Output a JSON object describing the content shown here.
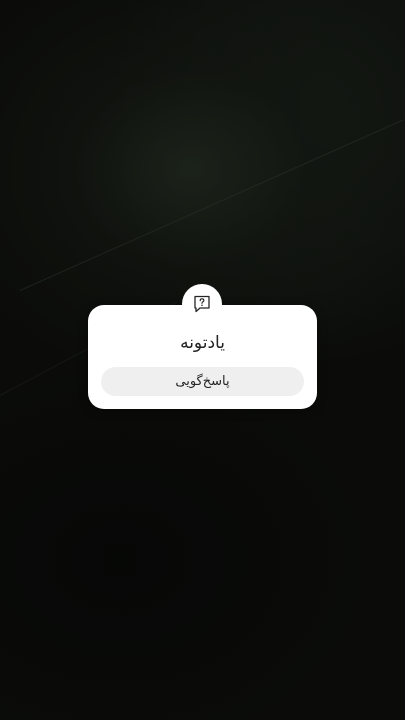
{
  "story": {
    "question_sticker": {
      "icon": "question-bubble-icon",
      "question_text": "یادتونه",
      "reply_placeholder": "پاسخ‌گویی"
    }
  },
  "colors": {
    "sticker_background": "#ffffff",
    "reply_pill_background": "#efefef",
    "text": "#222222"
  }
}
